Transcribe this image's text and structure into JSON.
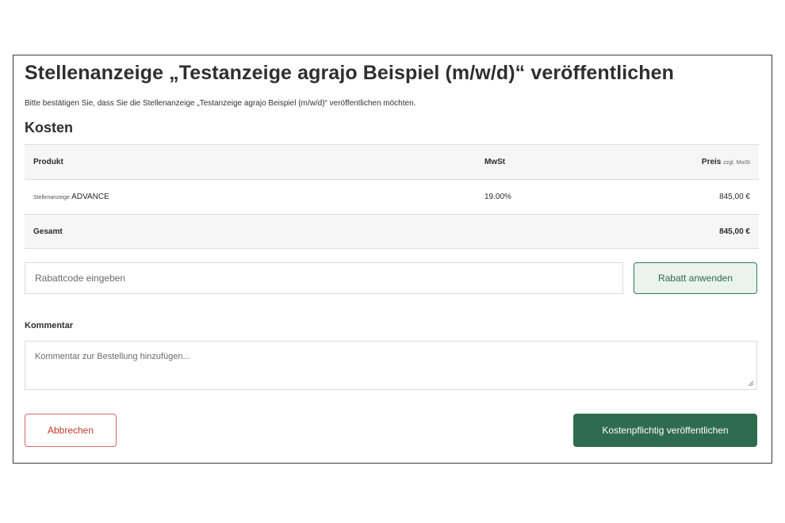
{
  "dialog": {
    "title": "Stellenanzeige „Testanzeige agrajo Beispiel (m/w/d)“ veröffentlichen",
    "subtitle": "Bitte bestätigen Sie, dass Sie die Stellenanzeige „Testanzeige agrajo Beispiel (m/w/d)“ veröffentlichen möchten."
  },
  "costs": {
    "section_title": "Kosten",
    "headers": {
      "product": "Produkt",
      "vat": "MwSt",
      "price": "Preis",
      "price_suffix": "zzgl. MwSt"
    },
    "items": [
      {
        "product_prefix": "Stellenanzeige",
        "product_name": "ADVANCE",
        "vat": "19.00%",
        "price": "845,00 €"
      }
    ],
    "total": {
      "label": "Gesamt",
      "price": "845,00 €"
    }
  },
  "discount": {
    "placeholder": "Rabattcode eingeben",
    "button_label": "Rabatt anwenden"
  },
  "comment": {
    "label": "Kommentar",
    "placeholder": "Kommentar zur Bestellung hinzufügen..."
  },
  "actions": {
    "cancel_label": "Abbrechen",
    "publish_label": "Kostenpflichtig veröffentlichen"
  },
  "colors": {
    "primary_green": "#2e6b4f",
    "light_green_bg": "#eaf3ee",
    "cancel_red": "#c0392b",
    "border_gray": "#dcdcdc"
  }
}
